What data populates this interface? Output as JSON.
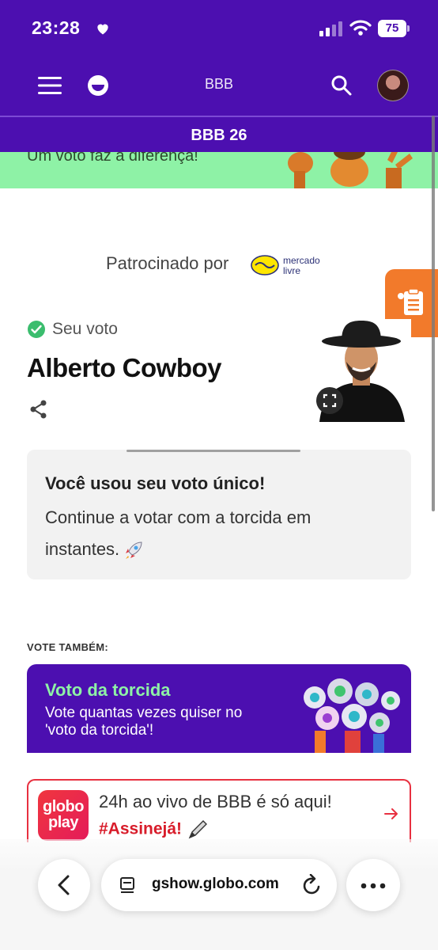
{
  "status_bar": {
    "time": "23:28",
    "battery": "75"
  },
  "header": {
    "title": "BBB"
  },
  "subnav": {
    "title": "BBB 26"
  },
  "promo": {
    "text": "Um voto faz a diferença!"
  },
  "sponsor": {
    "label": "Patrocinado por",
    "logo_text_1": "mercado",
    "logo_text_2": "livre"
  },
  "vote": {
    "status_label": "Seu voto",
    "candidate_name": "Alberto Cowboy"
  },
  "message": {
    "title": "Você usou seu voto único!",
    "body": "Continue a votar com a torcida em instantes."
  },
  "also_vote": {
    "heading": "VOTE TAMBÉM:",
    "card_title": "Voto da torcida",
    "card_desc": "Vote quantas vezes quiser no 'voto da torcida'!"
  },
  "globoplay": {
    "logo_line1": "globo",
    "logo_line2": "play",
    "line1": "24h ao vivo de BBB é só aqui!",
    "line2": "#Assinejá!"
  },
  "browser": {
    "url": "gshow.globo.com"
  },
  "colors": {
    "brand_purple": "#4c0fb0",
    "promo_green": "#8ef2a6",
    "accent_orange": "#f27a2b",
    "globoplay_red": "#e83040"
  },
  "icons": [
    "heart-icon",
    "signal-icon",
    "wifi-icon",
    "menu-icon",
    "globo-icon",
    "search-icon",
    "clipboard-icon",
    "check-circle-icon",
    "share-icon",
    "expand-icon",
    "rocket-icon",
    "pen-icon",
    "arrow-right-icon",
    "back-icon",
    "tabs-icon",
    "reload-icon",
    "more-icon"
  ]
}
